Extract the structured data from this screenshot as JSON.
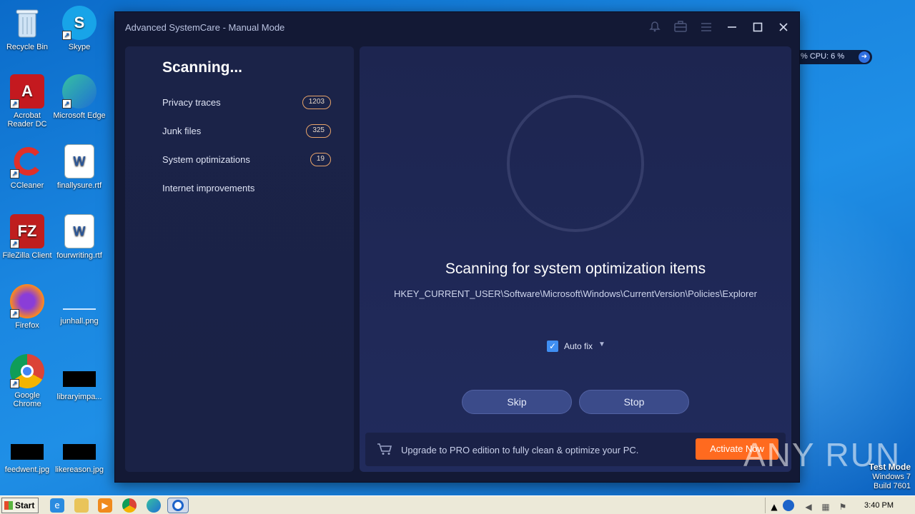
{
  "desktop": {
    "icons": [
      {
        "label": "Recycle Bin"
      },
      {
        "label": "Skype"
      },
      {
        "label": "Acrobat Reader DC"
      },
      {
        "label": "Microsoft Edge"
      },
      {
        "label": "CCleaner"
      },
      {
        "label": "finallysure.rtf"
      },
      {
        "label": "FileZilla Client"
      },
      {
        "label": "fourwriting.rtf"
      },
      {
        "label": "Firefox"
      },
      {
        "label": "junhall.png"
      },
      {
        "label": "Google Chrome"
      },
      {
        "label": "libraryimpa..."
      },
      {
        "label": "feedwent.jpg"
      },
      {
        "label": "likereason.jpg"
      }
    ]
  },
  "perf_widget": {
    "text": "% CPU: 6 %"
  },
  "window": {
    "title": "Advanced SystemCare - Manual Mode",
    "controls": {
      "bell": "bell-icon",
      "toolbox": "toolbox-icon",
      "menu": "menu-icon",
      "minimize": "minimize-icon",
      "maximize": "maximize-icon",
      "close": "close-icon"
    }
  },
  "scan": {
    "heading": "Scanning...",
    "categories": [
      {
        "label": "Privacy traces",
        "count": "1203"
      },
      {
        "label": "Junk files",
        "count": "325"
      },
      {
        "label": "System optimizations",
        "count": "19"
      },
      {
        "label": "Internet improvements",
        "count": ""
      }
    ],
    "status_title": "Scanning for system optimization items",
    "status_path": "HKEY_CURRENT_USER\\Software\\Microsoft\\Windows\\CurrentVersion\\Policies\\Explorer",
    "auto_fix_label": "Auto fix",
    "auto_fix_checked": true,
    "skip_label": "Skip",
    "stop_label": "Stop"
  },
  "promo": {
    "text": "Upgrade to PRO edition to fully clean & optimize your PC.",
    "button_label": "Activate Now"
  },
  "watermark": {
    "text": "ANY RUN"
  },
  "test_mode": {
    "line1": "Test Mode",
    "line2": "Windows 7",
    "line3": "Build 7601"
  },
  "taskbar": {
    "start_label": "Start",
    "clock": "3:40 PM"
  },
  "colors": {
    "accent_orange": "#ff6a1f",
    "badge_border": "#e9a46a",
    "checkbox_blue": "#3f8ef2",
    "window_bg": "#131935"
  }
}
